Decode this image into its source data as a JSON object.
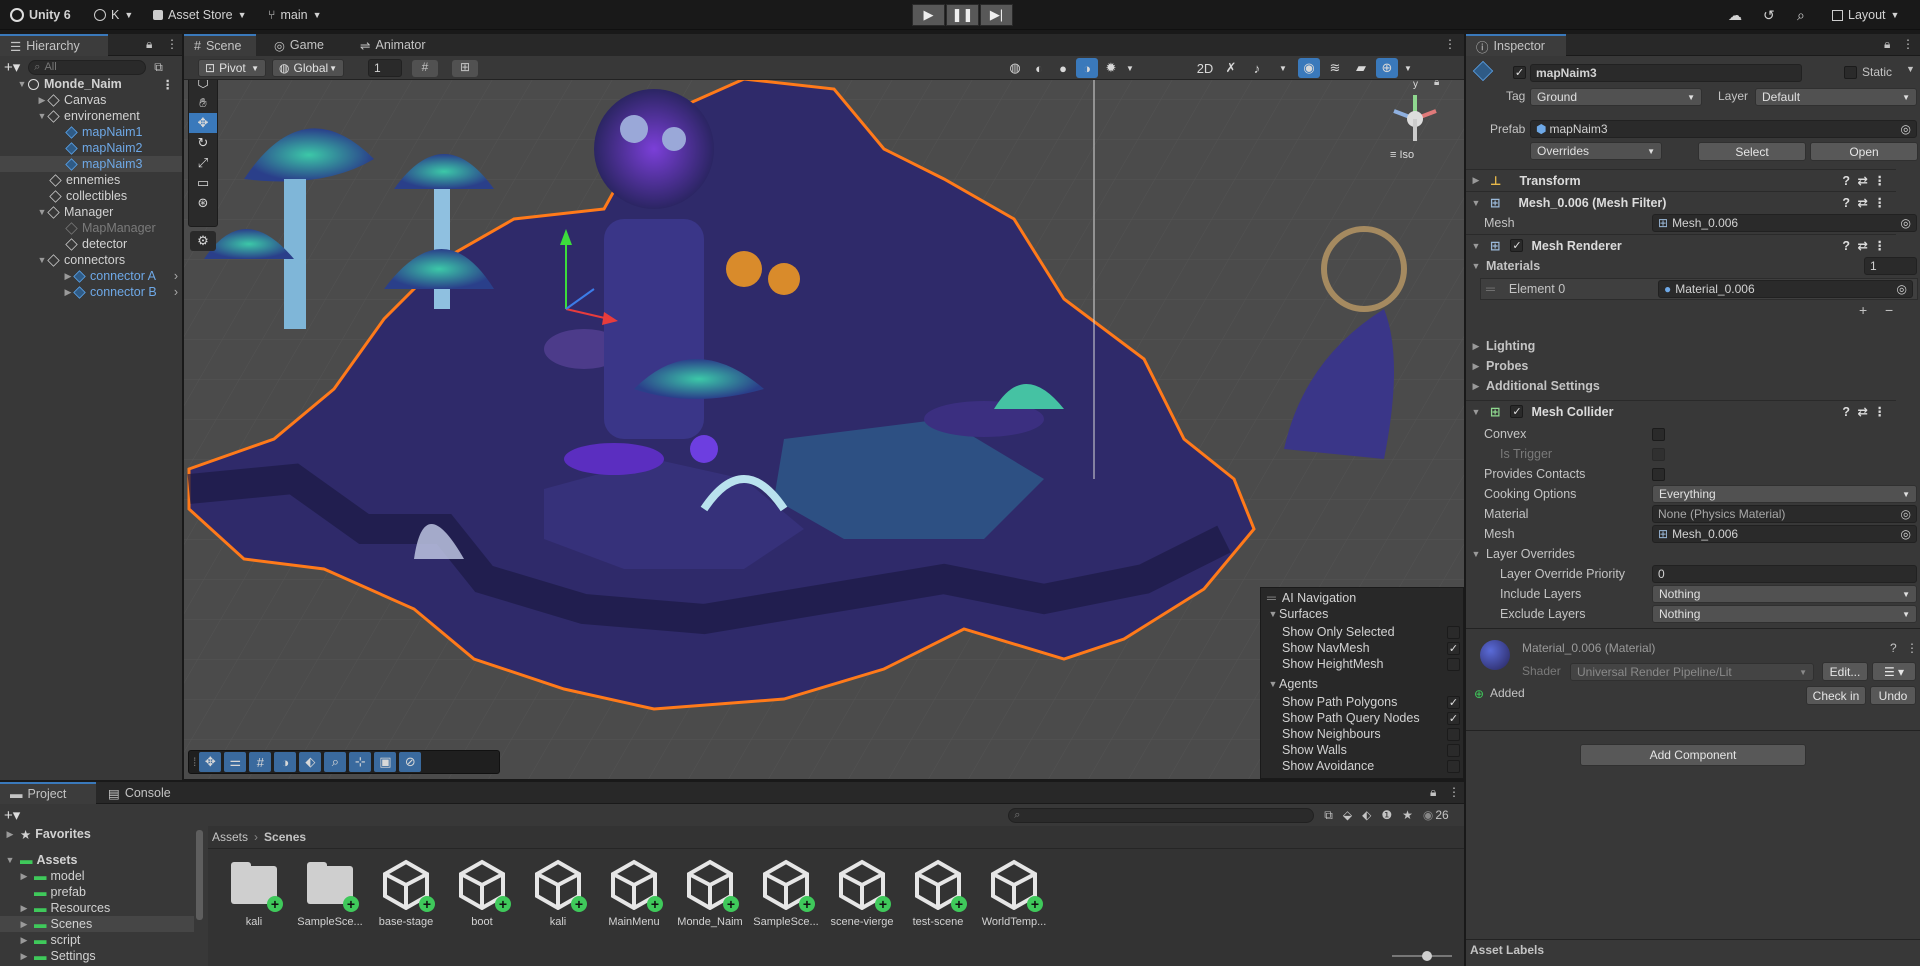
{
  "topbar": {
    "app": "Unity 6",
    "account": "K",
    "asset_store": "Asset Store",
    "branch": "main",
    "layout": "Layout"
  },
  "hierarchy": {
    "tab": "Hierarchy",
    "search_placeholder": "All",
    "items": [
      {
        "label": "Monde_Naim"
      },
      {
        "label": "Canvas"
      },
      {
        "label": "environement"
      },
      {
        "label": "mapNaim1"
      },
      {
        "label": "mapNaim2"
      },
      {
        "label": "mapNaim3"
      },
      {
        "label": "ennemies"
      },
      {
        "label": "collectibles"
      },
      {
        "label": "Manager"
      },
      {
        "label": "MapManager"
      },
      {
        "label": "detector"
      },
      {
        "label": "connectors"
      },
      {
        "label": "connector A"
      },
      {
        "label": "connector B"
      }
    ]
  },
  "scene": {
    "tabs": [
      "Scene",
      "Game",
      "Animator"
    ],
    "pivot": "Pivot",
    "global": "Global",
    "snap_value": "1",
    "gizmo_label": "Iso",
    "gizmo_y": "y",
    "ai_nav": {
      "title": "AI Navigation",
      "surfaces_header": "Surfaces",
      "surfaces": [
        {
          "label": "Show Only Selected",
          "checked": false
        },
        {
          "label": "Show NavMesh",
          "checked": true
        },
        {
          "label": "Show HeightMesh",
          "checked": false
        }
      ],
      "agents_header": "Agents",
      "agents": [
        {
          "label": "Show Path Polygons",
          "checked": true
        },
        {
          "label": "Show Path Query Nodes",
          "checked": true
        },
        {
          "label": "Show Neighbours",
          "checked": false
        },
        {
          "label": "Show Walls",
          "checked": false
        },
        {
          "label": "Show Avoidance",
          "checked": false
        }
      ]
    }
  },
  "inspector": {
    "tab": "Inspector",
    "object_name": "mapNaim3",
    "static_label": "Static",
    "tag_label": "Tag",
    "tag_value": "Ground",
    "layer_label": "Layer",
    "layer_value": "Default",
    "prefab_label": "Prefab",
    "prefab_value": "mapNaim3",
    "overrides": "Overrides",
    "select_btn": "Select",
    "open_btn": "Open",
    "transform": "Transform",
    "mesh_filter": "Mesh_0.006 (Mesh Filter)",
    "mesh_label": "Mesh",
    "mesh_value": "Mesh_0.006",
    "mesh_renderer": "Mesh Renderer",
    "materials_label": "Materials",
    "materials_count": "1",
    "element0_label": "Element 0",
    "element0_value": "Material_0.006",
    "lighting": "Lighting",
    "probes": "Probes",
    "additional": "Additional Settings",
    "mesh_collider": "Mesh Collider",
    "convex": "Convex",
    "is_trigger": "Is Trigger",
    "provides_contacts": "Provides Contacts",
    "cooking_label": "Cooking Options",
    "cooking_value": "Everything",
    "material_label": "Material",
    "material_value": "None (Physics Material)",
    "collider_mesh_label": "Mesh",
    "collider_mesh_value": "Mesh_0.006",
    "layer_overrides": "Layer Overrides",
    "override_priority_label": "Layer Override Priority",
    "override_priority_value": "0",
    "include_label": "Include Layers",
    "include_value": "Nothing",
    "exclude_label": "Exclude Layers",
    "exclude_value": "Nothing",
    "material_asset": "Material_0.006 (Material)",
    "shader_label": "Shader",
    "shader_value": "Universal Render Pipeline/Lit",
    "edit_btn": "Edit...",
    "added_label": "Added",
    "checkin_btn": "Check in",
    "undo_btn": "Undo",
    "add_component": "Add Component",
    "asset_labels": "Asset Labels"
  },
  "project": {
    "tabs": [
      "Project",
      "Console"
    ],
    "favorites": "Favorites",
    "assets_root": "Assets",
    "folders": [
      "model",
      "prefab",
      "Resources",
      "Scenes",
      "script",
      "Settings"
    ],
    "breadcrumb": [
      "Assets",
      "Scenes"
    ],
    "hidden_count": "26",
    "assets": [
      {
        "label": "kali",
        "kind": "folder"
      },
      {
        "label": "SampleSce...",
        "kind": "folder"
      },
      {
        "label": "base-stage",
        "kind": "scene"
      },
      {
        "label": "boot",
        "kind": "scene"
      },
      {
        "label": "kali",
        "kind": "scene"
      },
      {
        "label": "MainMenu",
        "kind": "scene"
      },
      {
        "label": "Monde_Naim",
        "kind": "scene"
      },
      {
        "label": "SampleSce...",
        "kind": "scene"
      },
      {
        "label": "scene-vierge",
        "kind": "scene"
      },
      {
        "label": "test-scene",
        "kind": "scene"
      },
      {
        "label": "WorldTemp...",
        "kind": "scene"
      }
    ]
  },
  "colors": {
    "accent_blue": "#3a79bb",
    "selection_orange": "#ff7a1a",
    "prefab_blue": "#5ca3e8"
  }
}
